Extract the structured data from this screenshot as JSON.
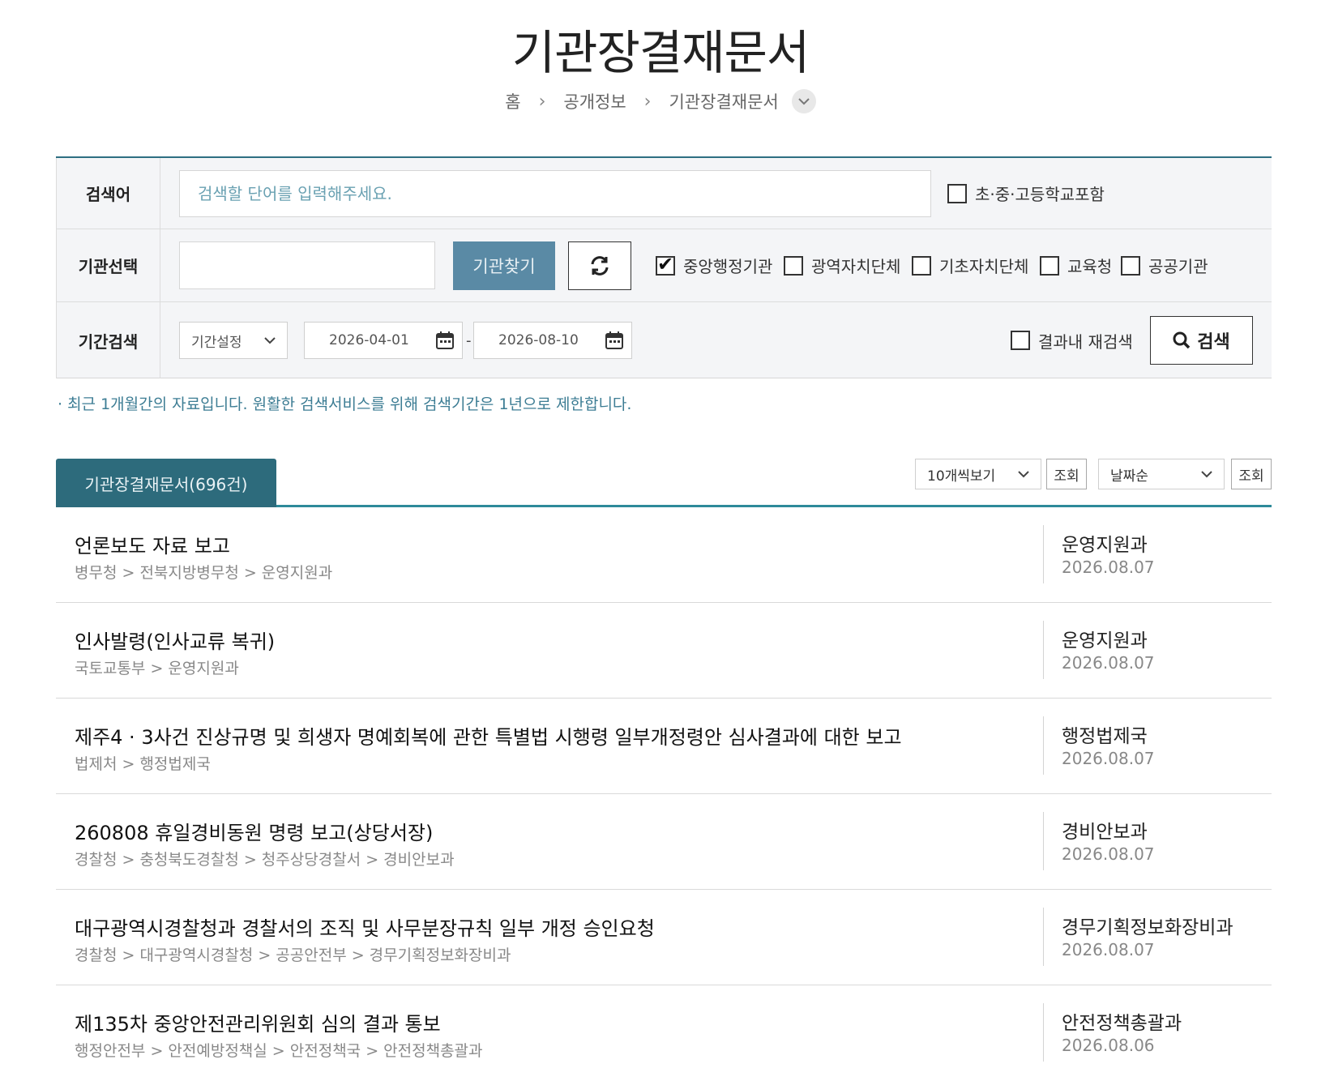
{
  "page_title": "기관장결재문서",
  "breadcrumb": {
    "items": [
      "홈",
      "공개정보",
      "기관장결재문서"
    ]
  },
  "search": {
    "keyword_label": "검색어",
    "keyword_placeholder": "검색할 단어를 입력해주세요.",
    "school_option": {
      "label": "초·중·고등학교포함",
      "checked": false
    },
    "org_label": "기관선택",
    "find_button": "기관찾기",
    "org_types": [
      {
        "label": "중앙행정기관",
        "checked": true
      },
      {
        "label": "광역자치단체",
        "checked": false
      },
      {
        "label": "기초자치단체",
        "checked": false
      },
      {
        "label": "교육청",
        "checked": false
      },
      {
        "label": "공공기관",
        "checked": false
      }
    ],
    "period_label": "기간검색",
    "period_select": "기간설정",
    "date_from": "2026-04-01",
    "date_sep": "-",
    "date_to": "2026-08-10",
    "research_option": {
      "label": "결과내 재검색",
      "checked": false
    },
    "search_button": "검색"
  },
  "notice": "· 최근 1개월간의 자료입니다. 원활한 검색서비스를 위해 검색기간은 1년으로 제한합니다.",
  "results": {
    "tab_label": "기관장결재문서(696건)",
    "per_page": "10개씩보기",
    "per_page_button": "조회",
    "sort": "날짜순",
    "sort_button": "조회",
    "items": [
      {
        "title": "언론보도 자료 보고",
        "path": "병무청 > 전북지방병무청 > 운영지원과",
        "dept": "운영지원과",
        "date": "2026.08.07"
      },
      {
        "title": "인사발령(인사교류 복귀)",
        "path": "국토교통부 > 운영지원과",
        "dept": "운영지원과",
        "date": "2026.08.07"
      },
      {
        "title": "제주4 · 3사건 진상규명 및 희생자 명예회복에 관한 특별법 시행령 일부개정령안 심사결과에 대한 보고",
        "path": "법제처 > 행정법제국",
        "dept": "행정법제국",
        "date": "2026.08.07"
      },
      {
        "title": "260808 휴일경비동원 명령 보고(상당서장)",
        "path": "경찰청 > 충청북도경찰청 > 청주상당경찰서 > 경비안보과",
        "dept": "경비안보과",
        "date": "2026.08.07"
      },
      {
        "title": "대구광역시경찰청과 경찰서의 조직 및 사무분장규칙 일부 개정 승인요청",
        "path": "경찰청 > 대구광역시경찰청 > 공공안전부 > 경무기획정보화장비과",
        "dept": "경무기획정보화장비과",
        "date": "2026.08.07"
      },
      {
        "title": "제135차 중앙안전관리위원회 심의 결과 통보",
        "path": "행정안전부 > 안전예방정책실 > 안전정책국 > 안전정책총괄과",
        "dept": "안전정책총괄과",
        "date": "2026.08.06"
      }
    ]
  }
}
